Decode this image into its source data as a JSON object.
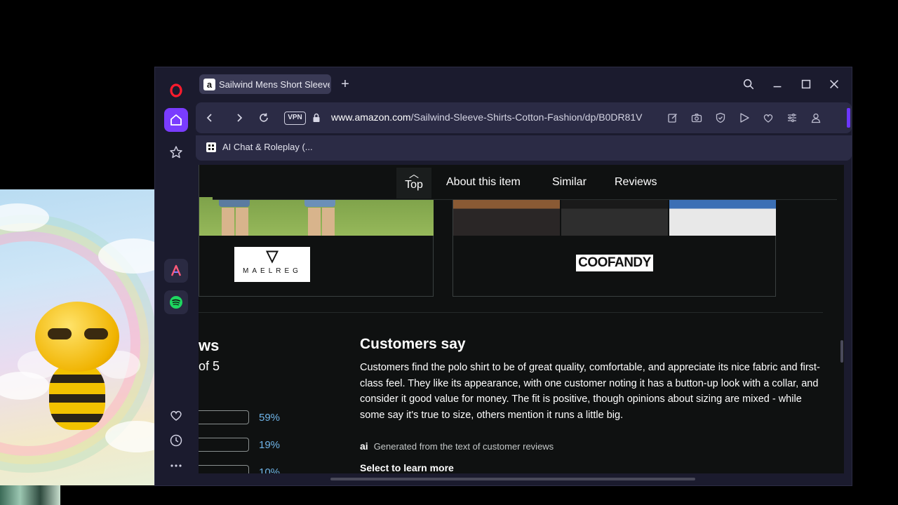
{
  "browser": {
    "tab": {
      "title": "Sailwind Mens Short Sleeve",
      "favicon_letter": "a"
    },
    "address": {
      "vpn_label": "VPN",
      "url_host": "www.amazon.com",
      "url_path": "/Sailwind-Sleeve-Shirts-Cotton-Fashion/dp/B0DR81V"
    },
    "bookmarks": [
      {
        "label": "AI Chat & Roleplay (..."
      }
    ]
  },
  "page": {
    "sticky_nav": {
      "top_label": "Top",
      "links": [
        "About this item",
        "Similar",
        "Reviews"
      ]
    },
    "brands": [
      {
        "logo_symbol": "▽",
        "logo_text": "MAELREG"
      },
      {
        "logo_text": "COOFANDY"
      }
    ],
    "ratings": {
      "title_fragment": "ws",
      "subtitle_fragment": "of 5",
      "rows": [
        {
          "pct": "59%"
        },
        {
          "pct": "19%"
        },
        {
          "pct": "10%"
        }
      ]
    },
    "customers_say": {
      "title": "Customers say",
      "text": "Customers find the polo shirt to be of great quality, comfortable, and appreciate its nice fabric and first-class feel. They like its appearance, with one customer noting it has a button-up look with a collar, and consider it good value for money. The fit is positive, though opinions about sizing are mixed - while some say it's true to size, others mention it runs a little big.",
      "ai_icon_text": "ai",
      "ai_note": "Generated from the text of customer reviews",
      "select_label": "Select to learn more"
    }
  },
  "colors": {
    "opera_red": "#ff1b2d",
    "accent_purple": "#7a3cff",
    "link_blue": "#6fb4e8",
    "spotify_green": "#1ed760"
  }
}
